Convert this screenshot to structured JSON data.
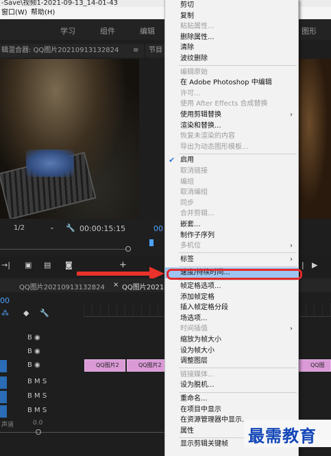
{
  "titlebar": {
    "text": "-Save\\视频1-2021-09-13_14-01-43"
  },
  "menubar": {
    "items": [
      "窗口(W)",
      "帮助(H)"
    ]
  },
  "workspace_tabs": [
    "学习",
    "组件",
    "编辑",
    "图形"
  ],
  "source_panel": {
    "title": "辑混合器: QQ图片20210913132824",
    "menu_glyph": "≡",
    "resolution": "1/2",
    "timecode": "00:00:15:15"
  },
  "program_panel": {
    "title": "节目",
    "timecode": "00"
  },
  "timeline": {
    "tabs": [
      "QQ图片20210913132824",
      "QQ图片2021"
    ],
    "close_glyph": "×",
    "timecode": "00",
    "tracks": [
      {
        "icons": "B ◉"
      },
      {
        "icons": "B ◉"
      },
      {
        "icons": "B ◉"
      },
      {
        "icons": "B M S"
      },
      {
        "icons": "B M S"
      },
      {
        "icons": "B M S"
      }
    ],
    "master_label": "声道",
    "master_value": "0.0",
    "clips": [
      "QQ图片2",
      "QQ图片2",
      "QQ图"
    ]
  },
  "context_menu": {
    "items": [
      {
        "label": "剪切",
        "disabled": false
      },
      {
        "label": "复制",
        "disabled": false
      },
      {
        "label": "粘贴属性...",
        "disabled": true
      },
      {
        "label": "删除属性...",
        "disabled": false
      },
      {
        "label": "清除",
        "disabled": false
      },
      {
        "label": "波纹删除",
        "disabled": false
      },
      {
        "sep": true
      },
      {
        "label": "编辑原始",
        "disabled": true
      },
      {
        "label": "在 Adobe Photoshop 中编辑",
        "disabled": false
      },
      {
        "label": "许可...",
        "disabled": true
      },
      {
        "label": "使用 After Effects 合成替换",
        "disabled": true
      },
      {
        "label": "使用剪辑替换",
        "disabled": false,
        "submenu": true
      },
      {
        "label": "渲染和替换...",
        "disabled": false
      },
      {
        "label": "恢复未渲染的内容",
        "disabled": true
      },
      {
        "label": "导出为动态图形模板...",
        "disabled": true
      },
      {
        "sep": true
      },
      {
        "label": "启用",
        "disabled": false,
        "checked": true
      },
      {
        "label": "取消链接",
        "disabled": true
      },
      {
        "label": "编组",
        "disabled": true
      },
      {
        "label": "取消编组",
        "disabled": true
      },
      {
        "label": "同步",
        "disabled": true
      },
      {
        "label": "合并剪辑...",
        "disabled": true
      },
      {
        "label": "嵌套...",
        "disabled": false
      },
      {
        "label": "制作子序列",
        "disabled": false
      },
      {
        "label": "多机位",
        "disabled": true,
        "submenu": true
      },
      {
        "sep": true
      },
      {
        "label": "标签",
        "disabled": false,
        "submenu": true
      },
      {
        "sep": true
      },
      {
        "label": "速度/持续时间...",
        "disabled": false,
        "highlighted": true
      },
      {
        "sep": true
      },
      {
        "label": "帧定格选项...",
        "disabled": false
      },
      {
        "label": "添加帧定格",
        "disabled": false
      },
      {
        "label": "插入帧定格分段",
        "disabled": false
      },
      {
        "label": "场选项...",
        "disabled": false
      },
      {
        "label": "时间插值",
        "disabled": true,
        "submenu": true
      },
      {
        "label": "缩放为帧大小",
        "disabled": false
      },
      {
        "label": "设为帧大小",
        "disabled": false
      },
      {
        "label": "调整图层",
        "disabled": false
      },
      {
        "sep": true
      },
      {
        "label": "链接媒体...",
        "disabled": true
      },
      {
        "label": "设为脱机...",
        "disabled": false
      },
      {
        "sep": true
      },
      {
        "label": "重命名...",
        "disabled": false
      },
      {
        "label": "在项目中显示",
        "disabled": false
      },
      {
        "label": "在资源管理器中显示...",
        "disabled": false
      },
      {
        "label": "属性",
        "disabled": false
      },
      {
        "sep": true
      },
      {
        "label": "显示剪辑关键帧",
        "disabled": false,
        "submenu": true
      }
    ]
  },
  "watermark": "最需教育"
}
